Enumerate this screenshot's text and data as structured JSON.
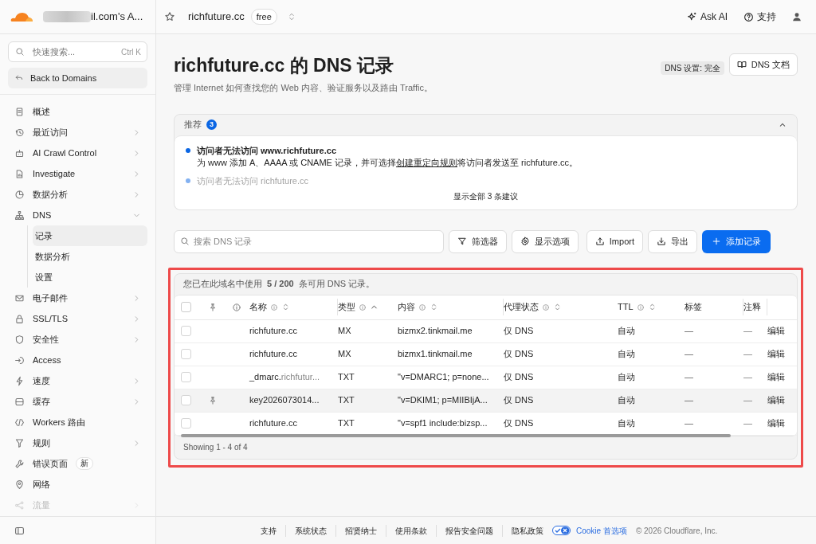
{
  "topbar": {
    "account": "il.com's A...",
    "zone": "richfuture.cc",
    "plan": "free",
    "ask_ai": "Ask AI",
    "support": "支持"
  },
  "sidebar": {
    "search": {
      "placeholder": "快速搜索...",
      "shortcut": "Ctrl K"
    },
    "back": "Back to Domains",
    "items": [
      {
        "label": "概述",
        "has_submenu": false,
        "faded": false
      },
      {
        "label": "最近访问",
        "has_submenu": true,
        "faded": false
      },
      {
        "label": "AI Crawl Control",
        "has_submenu": true,
        "faded": false
      },
      {
        "label": "Investigate",
        "has_submenu": true,
        "faded": false
      },
      {
        "label": "数据分析",
        "has_submenu": true,
        "faded": false
      },
      {
        "label": "DNS",
        "has_submenu": true,
        "faded": false,
        "expanded": true,
        "children": [
          {
            "label": "记录",
            "selected": true
          },
          {
            "label": "数据分析",
            "selected": false
          },
          {
            "label": "设置",
            "selected": false
          }
        ]
      },
      {
        "label": "电子邮件",
        "has_submenu": true,
        "faded": false
      },
      {
        "label": "SSL/TLS",
        "has_submenu": true,
        "faded": false
      },
      {
        "label": "安全性",
        "has_submenu": true,
        "faded": false
      },
      {
        "label": "Access",
        "has_submenu": false,
        "faded": false
      },
      {
        "label": "速度",
        "has_submenu": true,
        "faded": false
      },
      {
        "label": "缓存",
        "has_submenu": true,
        "faded": false
      },
      {
        "label": "Workers 路由",
        "has_submenu": false,
        "faded": false
      },
      {
        "label": "规则",
        "has_submenu": true,
        "faded": false
      },
      {
        "label": "错误页面",
        "has_submenu": false,
        "faded": false,
        "badge": "新"
      },
      {
        "label": "网络",
        "has_submenu": false,
        "faded": false
      },
      {
        "label": "流量",
        "has_submenu": true,
        "faded": true
      }
    ]
  },
  "page": {
    "title": "richfuture.cc 的 DNS 记录",
    "subtitle": "管理 Internet 如何查找您的 Web 内容、验证服务以及路由 Traffic。",
    "setup_badge": "DNS 设置: 完全",
    "docs_button": "DNS 文档"
  },
  "recommendations": {
    "title": "推荐",
    "count": "3",
    "expanded": true,
    "show_all": "显示全部 3 条建议",
    "items": [
      {
        "title": "访问者无法访问 www.richfuture.cc",
        "desc_before": "为 www 添加 A、AAAA 或 CNAME 记录，并可选择",
        "desc_link": "创建重定向规则",
        "desc_after": "将访问者发送至 richfuture.cc。",
        "faded": false
      },
      {
        "title": "访问者无法访问 richfuture.cc",
        "faded": true
      }
    ]
  },
  "toolbar": {
    "search_placeholder": "搜索 DNS 记录",
    "filter": "筛选器",
    "display": "显示选项",
    "import": "Import",
    "export": "导出",
    "add": "添加记录"
  },
  "table": {
    "usage": "您已在此域名中使用 **5 / 200** 条可用 DNS 记录。",
    "all_selected": false,
    "columns": [
      {
        "label": "名称",
        "sortable": true,
        "sorted_ascending": false
      },
      {
        "label": "类型",
        "sortable": true,
        "sorted_ascending": true
      },
      {
        "label": "内容",
        "sortable": true,
        "sorted_ascending": false
      },
      {
        "label": "代理状态",
        "sortable": true,
        "sorted_ascending": false
      },
      {
        "label": "TTL",
        "sortable": true,
        "sorted_ascending": false
      },
      {
        "label": "标签",
        "sortable": false
      },
      {
        "label": "注释",
        "sortable": false
      }
    ],
    "rows": [
      {
        "name": "richfuture.cc",
        "type": "MX",
        "content": "bizmx2.tinkmail.me",
        "proxy": "仅 DNS",
        "ttl": "自动",
        "tags": "—",
        "comment": "—",
        "edit": "编辑",
        "checked": false,
        "hovered": false
      },
      {
        "name": "richfuture.cc",
        "type": "MX",
        "content": "bizmx1.tinkmail.me",
        "proxy": "仅 DNS",
        "ttl": "自动",
        "tags": "—",
        "comment": "—",
        "edit": "编辑",
        "checked": false,
        "hovered": false
      },
      {
        "name": "_dmarc.",
        "name_suffix": "richfutur...",
        "type": "TXT",
        "content": "\"v=DMARC1; p=none...",
        "proxy": "仅 DNS",
        "ttl": "自动",
        "tags": "—",
        "comment": "—",
        "edit": "编辑",
        "checked": false,
        "hovered": false
      },
      {
        "name": "key2026073014...",
        "type": "TXT",
        "content": "\"v=DKIM1; p=MIIBIjA...",
        "proxy": "仅 DNS",
        "ttl": "自动",
        "tags": "—",
        "comment": "—",
        "edit": "编辑",
        "checked": false,
        "hovered": true
      },
      {
        "name": "richfuture.cc",
        "type": "TXT",
        "content": "\"v=spf1 include:bizsp...",
        "proxy": "仅 DNS",
        "ttl": "自动",
        "tags": "—",
        "comment": "—",
        "edit": "编辑",
        "checked": false,
        "hovered": false
      }
    ],
    "footer": "Showing 1 - 4 of 4"
  },
  "footer": {
    "links": [
      "支持",
      "系统状态",
      "招贤纳士",
      "使用条款",
      "报告安全问题",
      "隐私政策"
    ],
    "cookie": "Cookie 首选项",
    "copyright": "© 2026 Cloudflare, Inc."
  }
}
